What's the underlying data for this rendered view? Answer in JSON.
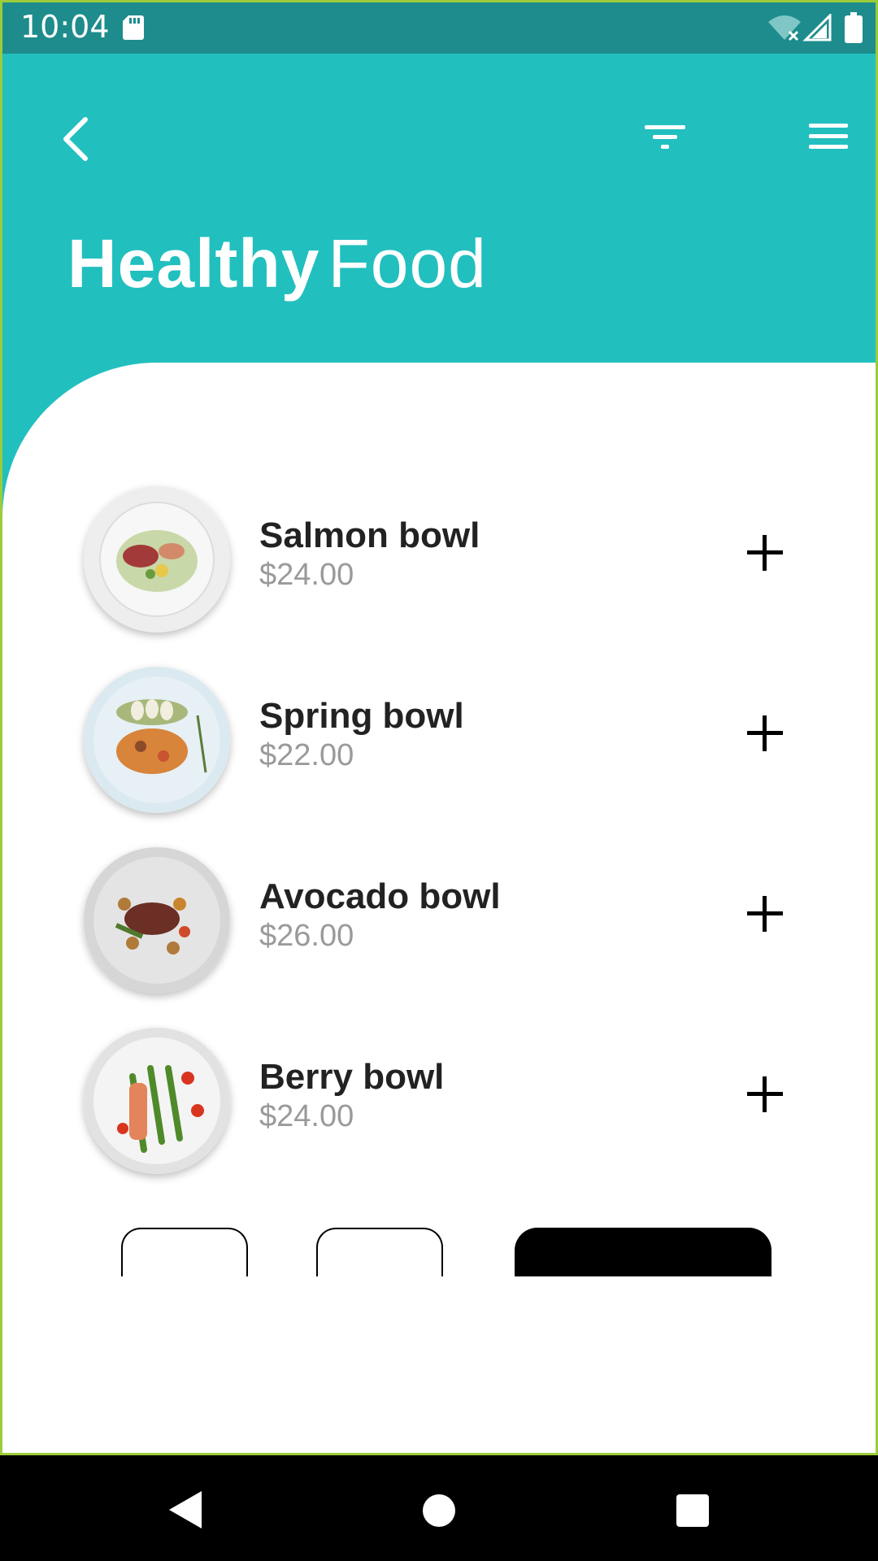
{
  "status_bar": {
    "time": "10:04"
  },
  "header": {
    "title_bold": "Healthy",
    "title_light": "Food"
  },
  "colors": {
    "accent": "#22bfbf",
    "status_bar": "#1e8c8c",
    "price": "#9a9a9a"
  },
  "items": [
    {
      "name": "Salmon bowl",
      "price": "$24.00"
    },
    {
      "name": "Spring bowl",
      "price": "$22.00"
    },
    {
      "name": "Avocado bowl",
      "price": "$26.00"
    },
    {
      "name": "Berry bowl",
      "price": "$24.00"
    }
  ],
  "icons": {
    "back": "back-arrow-icon",
    "filter": "filter-icon",
    "menu": "hamburger-menu-icon",
    "add": "plus-icon"
  }
}
